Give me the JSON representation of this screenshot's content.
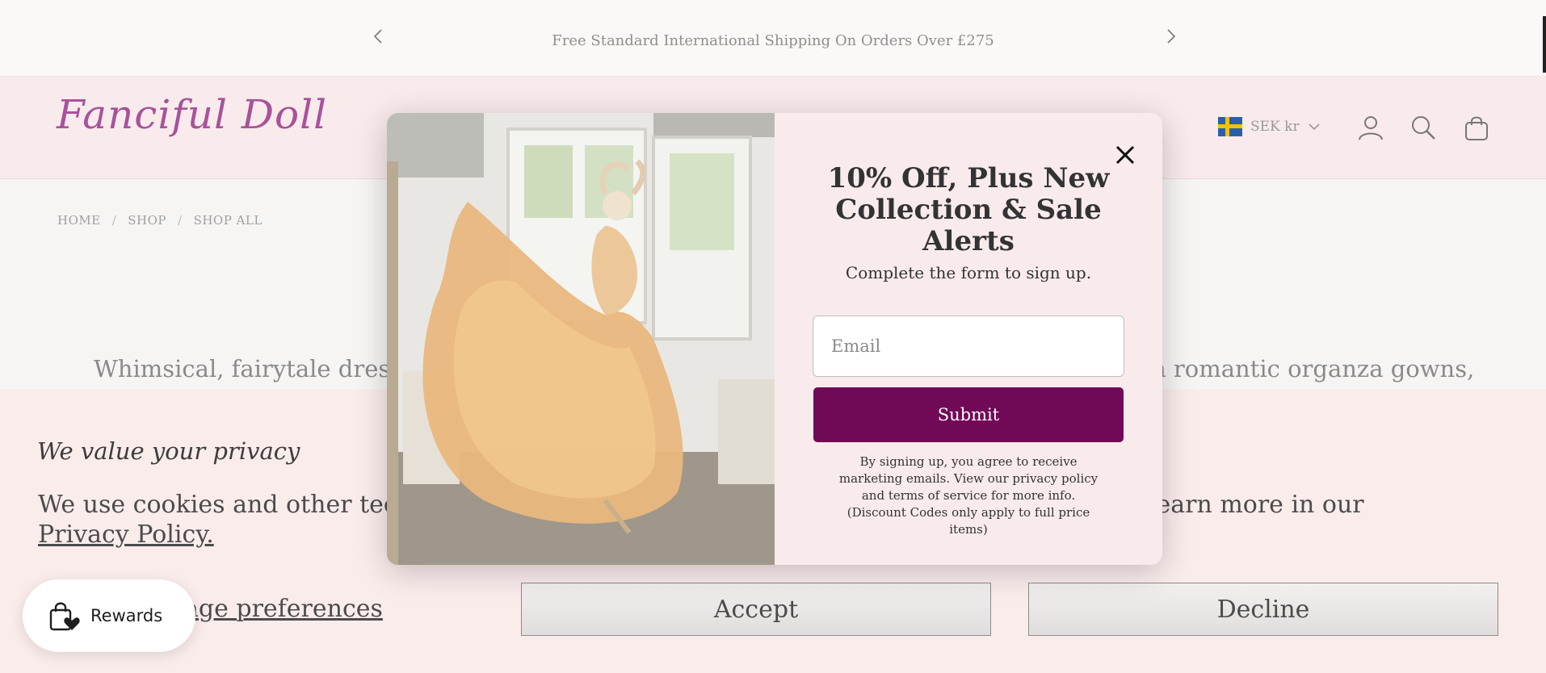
{
  "announcement": {
    "text": "Free Standard International Shipping On Orders Over £275",
    "prev_icon": "chevron-left-icon",
    "next_icon": "chevron-right-icon"
  },
  "header": {
    "logo": "Fanciful Doll",
    "currency": "SEK kr",
    "flag": "sweden-flag",
    "icons": [
      "account-icon",
      "search-icon",
      "bag-icon"
    ]
  },
  "breadcrumb": [
    "HOME",
    "SHOP",
    "SHOP ALL"
  ],
  "breadcrumb_sep": "/",
  "intro": {
    "left": "Whimsical, fairytale dresse",
    "right": "n romantic organza gowns,"
  },
  "cookie": {
    "title": "We value your privacy",
    "text_start": "We use cookies and other techno",
    "text_end": "analytics. Learn more in our",
    "link": "Privacy Policy.",
    "manage": "age preferences",
    "accept": "Accept",
    "decline": "Decline"
  },
  "rewards": {
    "label": "Rewards",
    "icon": "shopping-bag-heart-icon"
  },
  "popup": {
    "title": "10% Off, Plus New Collection & Sale Alerts",
    "subtitle": "Complete the form to sign up.",
    "email_placeholder": "Email",
    "submit": "Submit",
    "disclaimer": "By signing up, you agree to receive marketing emails. View our privacy policy and terms of service for more info. (Discount Codes only apply to full price items)"
  },
  "colors": {
    "brand": "#a8529b",
    "submit": "#720957",
    "banner": "#fbecec",
    "header": "#f9ebec"
  }
}
